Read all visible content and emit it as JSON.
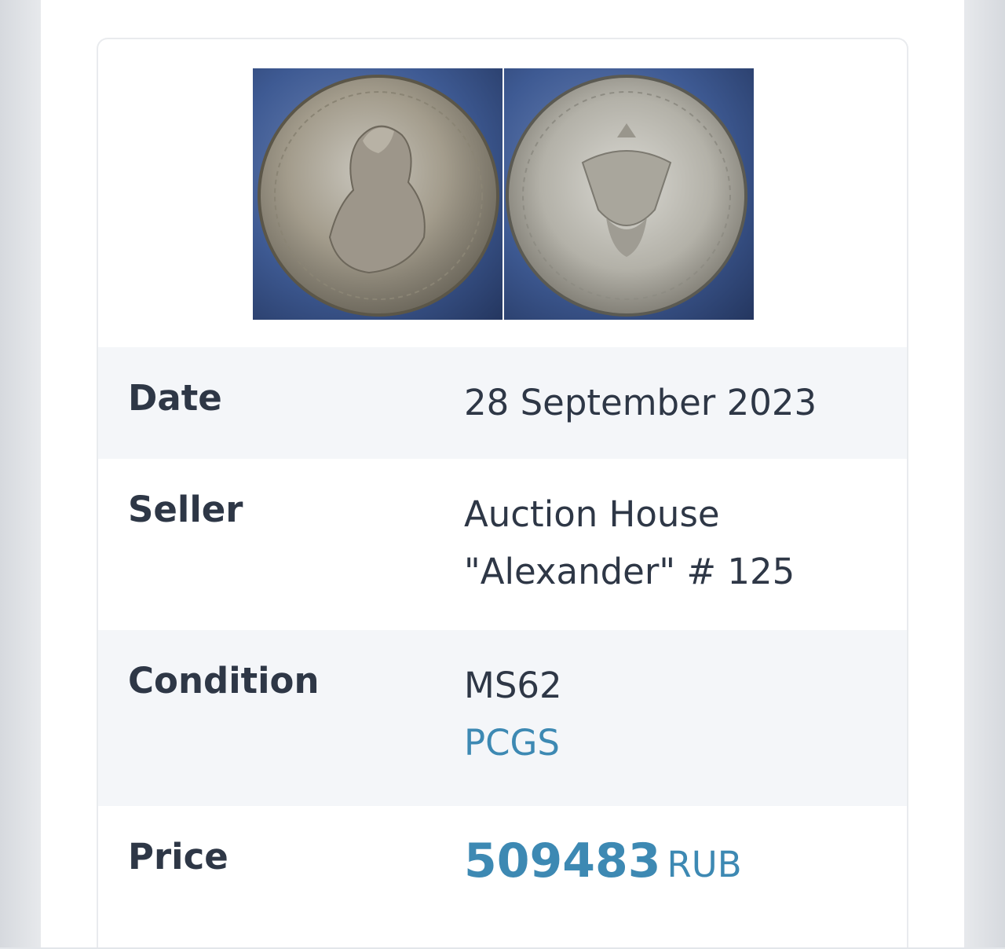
{
  "rows": {
    "date": {
      "label": "Date",
      "value": "28 September 2023"
    },
    "seller": {
      "label": "Seller",
      "value_line1": "Auction House",
      "value_line2": "\"Alexander\" # 125"
    },
    "condition": {
      "label": "Condition",
      "grade": "MS62",
      "grader": "PCGS"
    },
    "price": {
      "label": "Price",
      "amount": "509483",
      "currency": "RUB"
    }
  },
  "colors": {
    "accent": "#3d89b3",
    "text": "#2e3746",
    "row_shade": "#f4f6f9"
  },
  "images": {
    "obverse": "coin-obverse-image",
    "reverse": "coin-reverse-image"
  }
}
